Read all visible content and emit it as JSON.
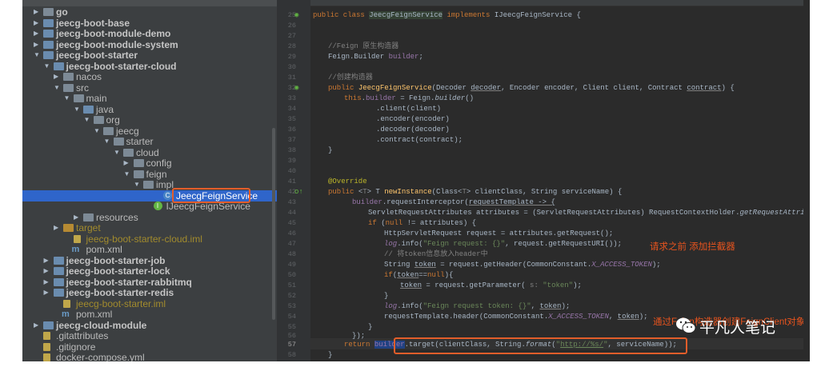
{
  "project_tree": {
    "rows": [
      {
        "label": "go",
        "icon": "folder-icon",
        "depth": 1,
        "arrow": "collapsed",
        "style": "bold"
      },
      {
        "label": "jeecg-boot-base",
        "icon": "module-folder-icon",
        "depth": 1,
        "arrow": "collapsed",
        "style": "bold"
      },
      {
        "label": "jeecg-boot-module-demo",
        "icon": "module-folder-icon",
        "depth": 1,
        "arrow": "collapsed",
        "style": "bold"
      },
      {
        "label": "jeecg-boot-module-system",
        "icon": "module-folder-icon",
        "depth": 1,
        "arrow": "collapsed",
        "style": "bold"
      },
      {
        "label": "jeecg-boot-starter",
        "icon": "module-folder-icon",
        "depth": 1,
        "arrow": "expanded",
        "style": "bold"
      },
      {
        "label": "jeecg-boot-starter-cloud",
        "icon": "module-folder-icon",
        "depth": 2,
        "arrow": "expanded",
        "style": "bold"
      },
      {
        "label": "nacos",
        "icon": "folder-icon",
        "depth": 3,
        "arrow": "collapsed",
        "style": ""
      },
      {
        "label": "src",
        "icon": "folder-icon",
        "depth": 3,
        "arrow": "expanded",
        "style": ""
      },
      {
        "label": "main",
        "icon": "folder-icon",
        "depth": 4,
        "arrow": "expanded",
        "style": ""
      },
      {
        "label": "java",
        "icon": "source-folder-icon",
        "depth": 5,
        "arrow": "expanded",
        "style": ""
      },
      {
        "label": "org",
        "icon": "package-icon",
        "depth": 6,
        "arrow": "expanded",
        "style": ""
      },
      {
        "label": "jeecg",
        "icon": "package-icon",
        "depth": 7,
        "arrow": "expanded",
        "style": ""
      },
      {
        "label": "starter",
        "icon": "package-icon",
        "depth": 8,
        "arrow": "expanded",
        "style": ""
      },
      {
        "label": "cloud",
        "icon": "package-icon",
        "depth": 9,
        "arrow": "expanded",
        "style": ""
      },
      {
        "label": "config",
        "icon": "package-icon",
        "depth": 10,
        "arrow": "collapsed",
        "style": ""
      },
      {
        "label": "feign",
        "icon": "package-icon",
        "depth": 10,
        "arrow": "expanded",
        "style": ""
      },
      {
        "label": "impl",
        "icon": "package-icon",
        "depth": 11,
        "arrow": "expanded",
        "style": ""
      },
      {
        "label": "JeecgFeignService",
        "icon": "class-icon",
        "depth": 13,
        "arrow": "none",
        "style": "selected"
      },
      {
        "label": "IJeecgFeignService",
        "icon": "interface-icon",
        "depth": 12,
        "arrow": "none",
        "style": ""
      },
      {
        "label": "resources",
        "icon": "resources-folder-icon",
        "depth": 5,
        "arrow": "collapsed",
        "style": ""
      },
      {
        "label": "target",
        "icon": "excluded-folder-icon",
        "depth": 3,
        "arrow": "collapsed",
        "style": "olive"
      },
      {
        "label": "jeecg-boot-starter-cloud.iml",
        "icon": "iml-file-icon",
        "depth": 4,
        "arrow": "none",
        "style": "olive"
      },
      {
        "label": "pom.xml",
        "icon": "maven-icon",
        "depth": 4,
        "arrow": "none",
        "style": ""
      },
      {
        "label": "jeecg-boot-starter-job",
        "icon": "module-folder-icon",
        "depth": 2,
        "arrow": "collapsed",
        "style": "bold"
      },
      {
        "label": "jeecg-boot-starter-lock",
        "icon": "module-folder-icon",
        "depth": 2,
        "arrow": "collapsed",
        "style": "bold"
      },
      {
        "label": "jeecg-boot-starter-rabbitmq",
        "icon": "module-folder-icon",
        "depth": 2,
        "arrow": "collapsed",
        "style": "bold"
      },
      {
        "label": "jeecg-boot-starter-redis",
        "icon": "module-folder-icon",
        "depth": 2,
        "arrow": "collapsed",
        "style": "bold"
      },
      {
        "label": "jeecg-boot-starter.iml",
        "icon": "iml-file-icon",
        "depth": 3,
        "arrow": "none",
        "style": "olive"
      },
      {
        "label": "pom.xml",
        "icon": "maven-icon",
        "depth": 3,
        "arrow": "none",
        "style": ""
      },
      {
        "label": "jeecg-cloud-module",
        "icon": "module-folder-icon",
        "depth": 1,
        "arrow": "collapsed",
        "style": "bold"
      },
      {
        "label": ".gitattributes",
        "icon": "file-icon",
        "depth": 1,
        "arrow": "none",
        "style": ""
      },
      {
        "label": ".gitignore",
        "icon": "file-icon",
        "depth": 1,
        "arrow": "none",
        "style": ""
      },
      {
        "label": "docker-compose.yml",
        "icon": "file-icon",
        "depth": 1,
        "arrow": "none",
        "style": ""
      }
    ]
  },
  "editor": {
    "line_numbers": [
      "25",
      "26",
      "27",
      "28",
      "29",
      "30",
      "31",
      "32",
      "33",
      "34",
      "35",
      "36",
      "37",
      "38",
      "39",
      "40",
      "41",
      "42",
      "43",
      "44",
      "45",
      "46",
      "47",
      "48",
      "49",
      "50",
      "51",
      "52",
      "53",
      "54",
      "55",
      "56",
      "57",
      "58"
    ],
    "annotations": {
      "interceptor_note": "请求之前 添加拦截器",
      "overlay_note": "通过Feign构造器创建FeignClient对象"
    },
    "watermark": "平凡人笔记"
  },
  "colors": {
    "accent": "#e35d2a",
    "selection": "#2f65ca",
    "editor_bg": "#2b2b2b",
    "tree_bg": "#3c3f41"
  }
}
